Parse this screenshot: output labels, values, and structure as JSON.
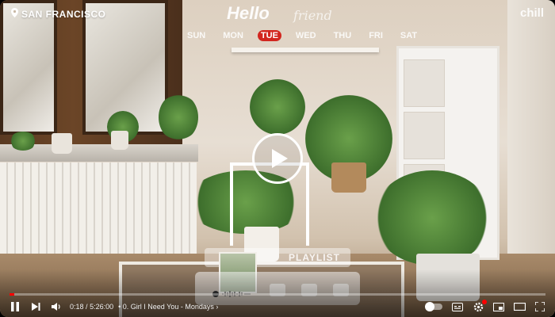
{
  "video": {
    "location": "SAN FRANCISCO",
    "channel_logo": "chill",
    "greeting": "Hello",
    "greeting_sub": "friend",
    "weekdays": [
      "SUN",
      "MON",
      "TUE",
      "WED",
      "THU",
      "FRI",
      "SAT"
    ],
    "active_day": "TUE",
    "playlist_label": "PLAYLIST"
  },
  "player": {
    "current_time": "0:18",
    "duration": "5:26:00",
    "time_separator": "/",
    "chapter": "0. Girl I Need You - Mondays",
    "progress_fraction": 0.001,
    "accent_color": "#ff0000"
  },
  "icons": {
    "play": "play-icon",
    "next": "next-icon",
    "volume": "volume-icon",
    "location": "location-pin-icon",
    "captions": "captions-icon",
    "settings": "settings-icon",
    "miniplayer": "miniplayer-icon",
    "theater": "theater-mode-icon",
    "fullscreen": "fullscreen-icon",
    "autoplay": "autoplay-toggle"
  }
}
